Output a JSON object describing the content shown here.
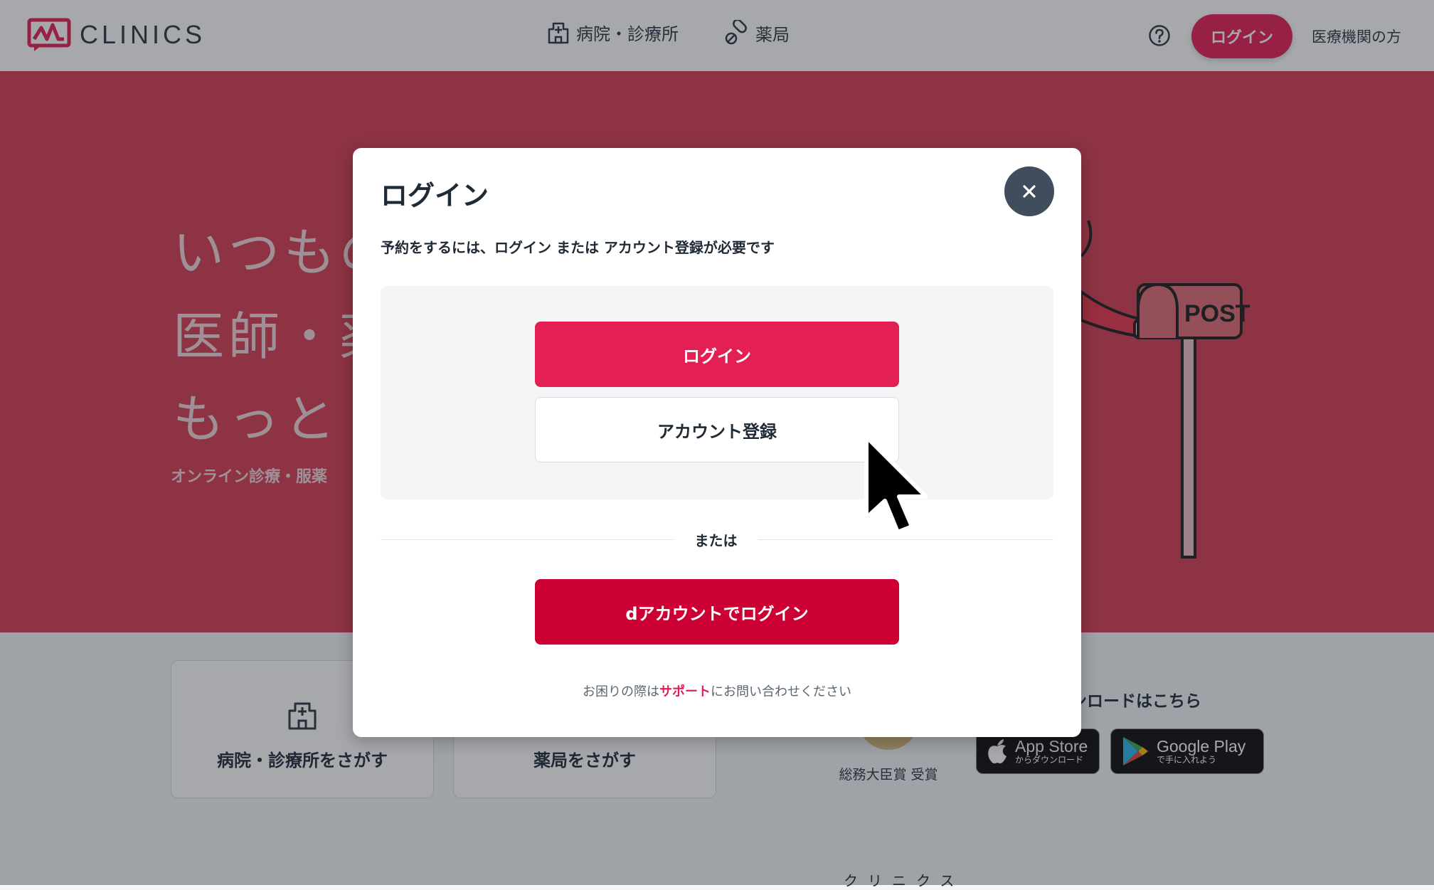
{
  "header": {
    "logo_text": "CLINICS",
    "nav_hospital": "病院・診療所",
    "nav_pharmacy": "薬局",
    "login_label": "ログイン",
    "medical_link": "医療機関の方"
  },
  "hero": {
    "line1": "いつもの",
    "line2": "医師・薬",
    "line3": "もっと",
    "subtitle": "オンライン診療・服薬",
    "mailbox_label": "POST"
  },
  "cards": {
    "hospital_label": "病院・診療所をさがす",
    "pharmacy_label": "薬局をさがす"
  },
  "award": {
    "label": "総務大臣賞 受賞"
  },
  "download": {
    "title": "ンロードはこちら",
    "apple_big": "App Store",
    "apple_small": "からダウンロード",
    "google_big": "Google Play",
    "google_small": "で手に入れよう"
  },
  "brand_kana": "クリニクス",
  "modal": {
    "title": "ログイン",
    "description": "予約をするには、ログイン または アカウント登録が必要です",
    "login_button": "ログイン",
    "register_button": "アカウント登録",
    "divider_text": "または",
    "daccount_button": "dアカウントでログイン",
    "help_prefix": "お困りの際は",
    "help_link": "サポート",
    "help_suffix": "にお問い合わせください"
  },
  "colors": {
    "brand_red": "#e41f53",
    "docomo_red": "#cc0033",
    "hero_red": "#d63c50",
    "close_button": "#3f4d5c"
  }
}
